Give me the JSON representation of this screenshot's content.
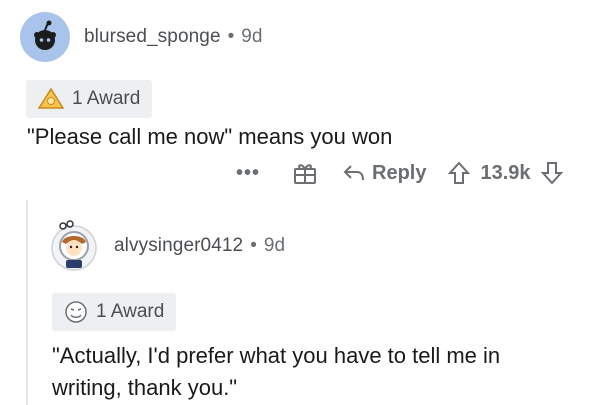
{
  "comment": {
    "username": "blursed_sponge",
    "separator": "•",
    "age": "9d",
    "award_label": "1 Award",
    "text": "\"Please call me now\" means you won",
    "actions": {
      "more_label": "•••",
      "reply_label": "Reply",
      "score": "13.9k"
    }
  },
  "reply": {
    "username": "alvysinger0412",
    "separator": "•",
    "age": "9d",
    "award_label": "1 Award",
    "text_line1": "\"Actually, I'd prefer what you have to tell me in",
    "text_line2": "writing, thank you.\""
  },
  "colors": {
    "avatar_bg": "#a9c4ea",
    "award_bg": "#edeff1",
    "muted_text": "#6b6f73"
  }
}
